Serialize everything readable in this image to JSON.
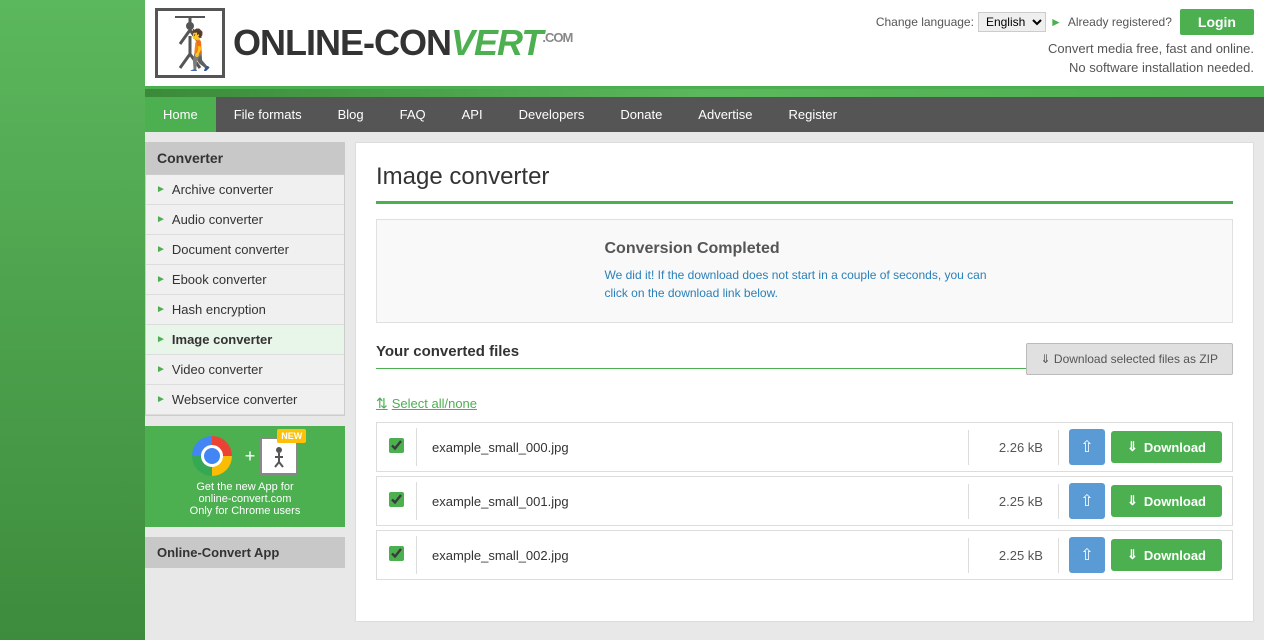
{
  "header": {
    "logo_text_part1": "ONLINE-CON",
    "logo_text_vert": "VERT",
    "logo_text_com": ".COM",
    "tagline_line1": "Convert media free, fast and online.",
    "tagline_line2": "No software installation needed.",
    "lang_label": "Change language:",
    "lang_value": "English",
    "already_registered": "Already registered?",
    "login_label": "Login"
  },
  "nav": {
    "items": [
      {
        "label": "Home",
        "active": false
      },
      {
        "label": "File formats",
        "active": false
      },
      {
        "label": "Blog",
        "active": false
      },
      {
        "label": "FAQ",
        "active": false
      },
      {
        "label": "API",
        "active": false
      },
      {
        "label": "Developers",
        "active": false
      },
      {
        "label": "Donate",
        "active": false
      },
      {
        "label": "Advertise",
        "active": false
      },
      {
        "label": "Register",
        "active": false
      }
    ]
  },
  "sidebar": {
    "converter_header": "Converter",
    "items": [
      {
        "label": "Archive converter",
        "active": false
      },
      {
        "label": "Audio converter",
        "active": false
      },
      {
        "label": "Document converter",
        "active": false
      },
      {
        "label": "Ebook converter",
        "active": false
      },
      {
        "label": "Hash encryption",
        "active": false
      },
      {
        "label": "Image converter",
        "active": true
      },
      {
        "label": "Video converter",
        "active": false
      },
      {
        "label": "Webservice converter",
        "active": false
      }
    ],
    "app_promo": {
      "text_line1": "Get the new App for",
      "text_line2": "online-convert.com",
      "text_line3": "Only for Chrome users",
      "new_badge": "NEW"
    },
    "oc_app_label": "Online-Convert App"
  },
  "main": {
    "page_title": "Image converter",
    "conversion_complete": {
      "title": "Conversion Completed",
      "text": "We did it! If the download does not start in a couple of seconds, you can click on the download link below."
    },
    "converted_files_header": "Your converted files",
    "download_zip_label": "Download selected files as ZIP",
    "select_all_label": "Select all/none",
    "files": [
      {
        "name": "example_small_000.jpg",
        "size": "2.26 kB"
      },
      {
        "name": "example_small_001.jpg",
        "size": "2.25 kB"
      },
      {
        "name": "example_small_002.jpg",
        "size": "2.25 kB"
      }
    ],
    "download_label": "Download"
  }
}
